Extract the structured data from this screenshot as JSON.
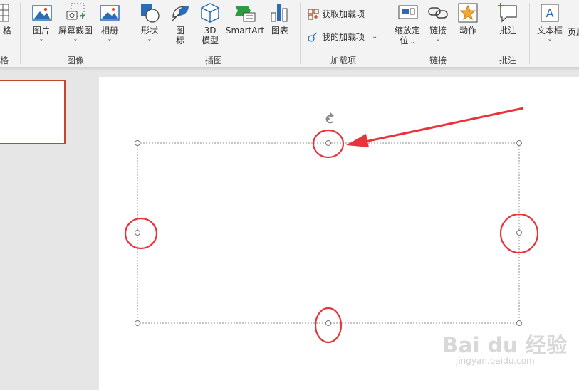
{
  "ribbon": {
    "partial_left_top": "格",
    "partial_left_group": "格",
    "groups": {
      "images": "图像",
      "illustrations": "插图",
      "addins": "加载项",
      "links": "链接",
      "comments": "批注"
    },
    "buttons": {
      "picture": "图片",
      "screenshot": "屏幕截图",
      "album": "相册",
      "shapes": "形状",
      "icons_line1": "图",
      "icons_line2": "标",
      "model3d_line1": "3D",
      "model3d_line2": "模型",
      "smartart": "SmartArt",
      "chart": "图表",
      "get_addins": "获取加载项",
      "my_addins": "我的加载项",
      "zoom_line1": "缩放定",
      "zoom_line2": "位",
      "link": "链接",
      "action": "动作",
      "comment": "批注",
      "textbox": "文本框",
      "header_partial": "页眉"
    }
  },
  "watermark": {
    "brand": "Bai du 经验",
    "url": "jingyan.baidu.com"
  },
  "colors": {
    "annotation_red": "#e8333a",
    "selection_border": "#c0472b",
    "icon_blue": "#2b6cb5"
  }
}
